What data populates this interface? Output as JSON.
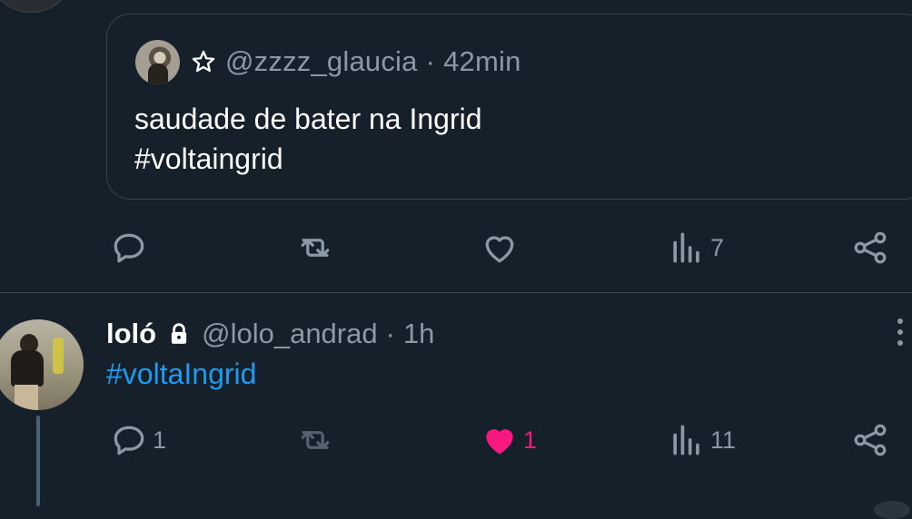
{
  "quoted_tweet": {
    "badge_icon": "star-outline-icon",
    "handle": "@zzzz_glaucia",
    "separator": "·",
    "time": "42min",
    "text_line1": "saudade de bater na Ingrid",
    "text_line2": "#voltaingrid"
  },
  "actions_top": {
    "reply_count": "",
    "retweet_count": "",
    "like_count": "",
    "views_count": "7"
  },
  "tweet": {
    "name": "loló",
    "badge_icon": "lock-icon",
    "handle": "@lolo_andrad",
    "separator": "·",
    "time": "1h",
    "text": "#voltaIngrid"
  },
  "actions_bottom": {
    "reply_count": "1",
    "retweet_count": "",
    "like_count": "1",
    "like_active": true,
    "views_count": "11"
  },
  "colors": {
    "background": "#15202b",
    "border": "#38444d",
    "muted_text": "#8b98a5",
    "link": "#1d9bf0",
    "like": "#f91880"
  }
}
